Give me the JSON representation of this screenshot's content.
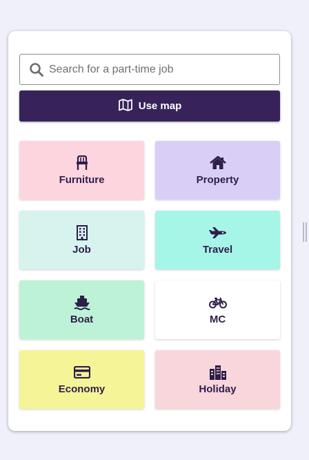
{
  "search": {
    "placeholder": "Search for a part-time job",
    "value": ""
  },
  "map_button": {
    "label": "Use map"
  },
  "categories": [
    {
      "label": "Furniture",
      "icon": "chair-icon",
      "color": "#fdd5df"
    },
    {
      "label": "Property",
      "icon": "home-icon",
      "color": "#d9cff6"
    },
    {
      "label": "Job",
      "icon": "building-icon",
      "color": "#d6f3ee"
    },
    {
      "label": "Travel",
      "icon": "airplane-icon",
      "color": "#a6f6e8"
    },
    {
      "label": "Boat",
      "icon": "ship-icon",
      "color": "#bdf2d6"
    },
    {
      "label": "MC",
      "icon": "bicycle-icon",
      "color": "#ffffff"
    },
    {
      "label": "Economy",
      "icon": "card-icon",
      "color": "#f5f598"
    },
    {
      "label": "Holiday",
      "icon": "city-icon",
      "color": "#f9d6dc"
    }
  ],
  "colors": {
    "accent": "#37235a",
    "text_dark": "#2d1e4a",
    "page_bg": "#f0f0fa"
  }
}
